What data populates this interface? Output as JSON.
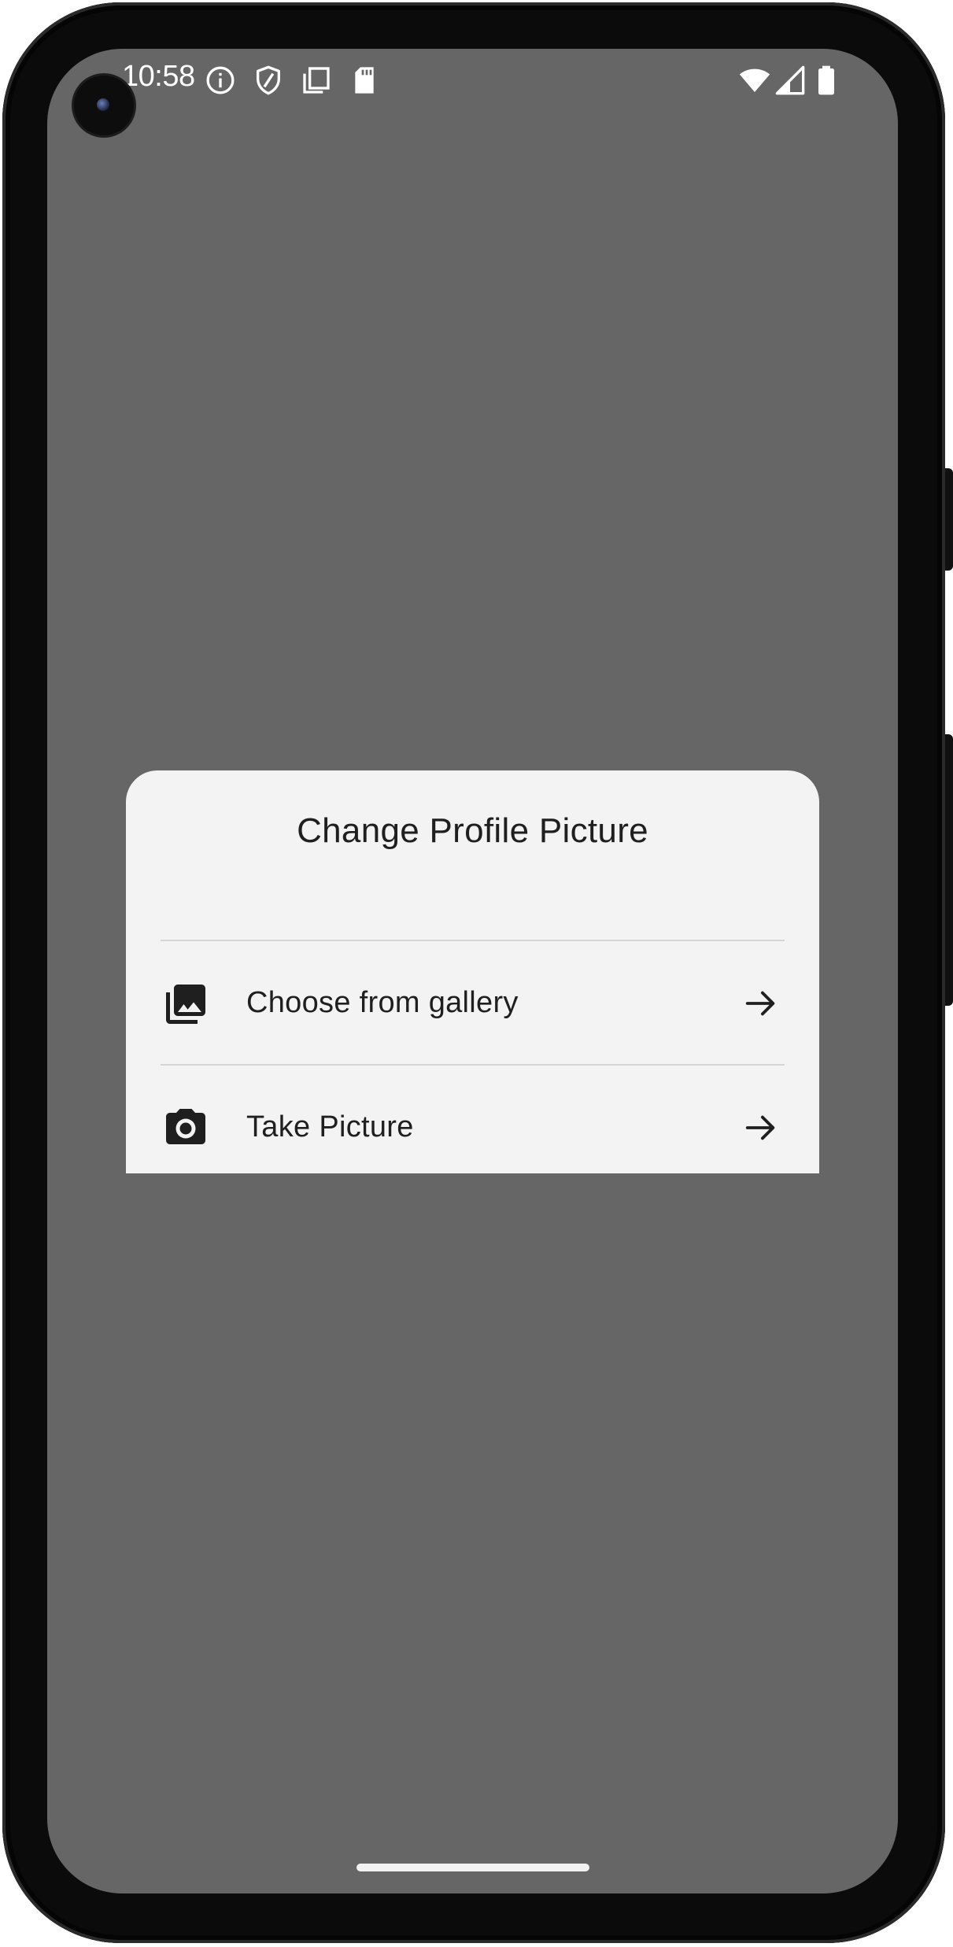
{
  "status_bar": {
    "time": "10:58",
    "left_icons": [
      "info-icon",
      "shield-icon",
      "copy-icon",
      "sd-card-icon"
    ],
    "right_icons": [
      "wifi-icon",
      "signal-icon",
      "battery-icon"
    ]
  },
  "dialog": {
    "title": "Change Profile Picture",
    "options": [
      {
        "label": "Choose from gallery",
        "icon": "photo-library-icon",
        "trailing_icon": "arrow-forward-icon"
      },
      {
        "label": "Take Picture",
        "icon": "camera-icon",
        "trailing_icon": "arrow-forward-icon"
      }
    ]
  },
  "colors": {
    "scrim": "#666666",
    "dialog_background": "#f3f3f3",
    "text": "#1f1f1f",
    "divider": "#d4d4d4"
  }
}
